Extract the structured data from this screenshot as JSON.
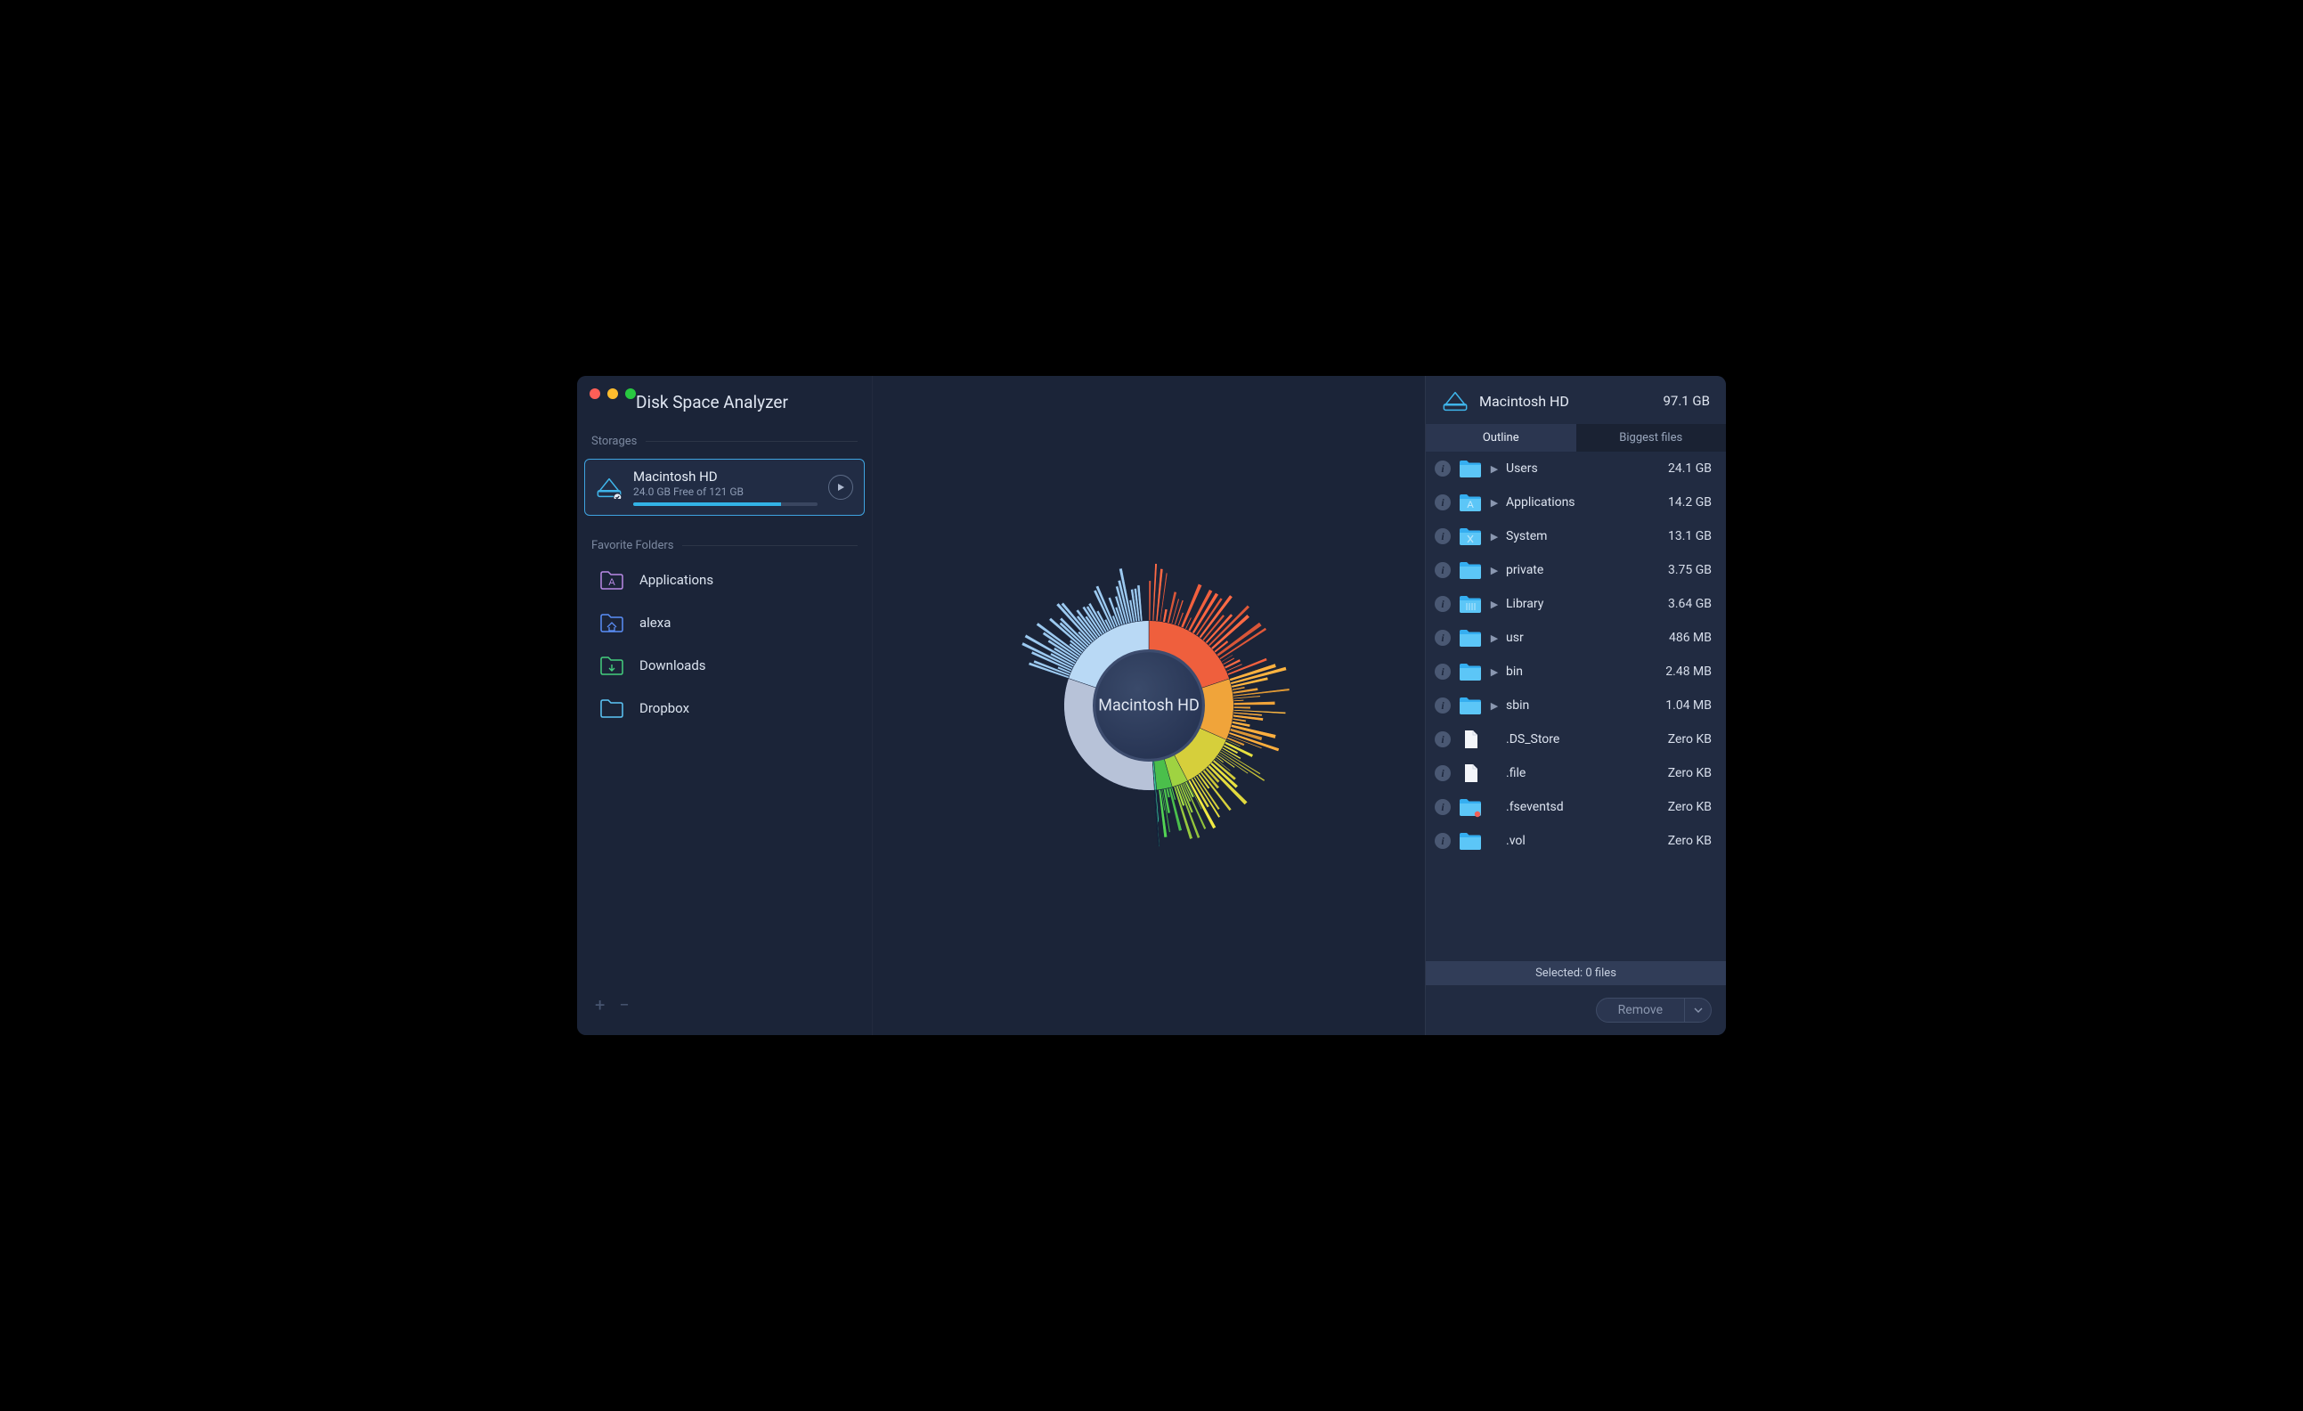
{
  "app_title": "Disk Space Analyzer",
  "sections": {
    "storages": "Storages",
    "favorites": "Favorite Folders"
  },
  "storage": {
    "name": "Macintosh HD",
    "subtitle": "24.0 GB Free of 121 GB",
    "used_pct": 80
  },
  "favorites": [
    {
      "label": "Applications",
      "icon": "applications",
      "tint": "#b98ae6"
    },
    {
      "label": "alexa",
      "icon": "home",
      "tint": "#5a8ef7"
    },
    {
      "label": "Downloads",
      "icon": "downloads",
      "tint": "#44cf7e"
    },
    {
      "label": "Dropbox",
      "icon": "folder",
      "tint": "#5cc6f7"
    }
  ],
  "center_title": "Macintosh HD",
  "right_header": {
    "title": "Macintosh HD",
    "size": "97.1 GB"
  },
  "tabs": {
    "outline": "Outline",
    "biggest": "Biggest files"
  },
  "filelist": [
    {
      "name": "Users",
      "size": "24.1 GB",
      "icon": "folder",
      "disclosure": true
    },
    {
      "name": "Applications",
      "size": "14.2 GB",
      "icon": "applications",
      "disclosure": true
    },
    {
      "name": "System",
      "size": "13.1 GB",
      "icon": "system",
      "disclosure": true
    },
    {
      "name": "private",
      "size": "3.75 GB",
      "icon": "folder",
      "disclosure": true
    },
    {
      "name": "Library",
      "size": "3.64 GB",
      "icon": "library",
      "disclosure": true
    },
    {
      "name": "usr",
      "size": "486 MB",
      "icon": "folder",
      "disclosure": true
    },
    {
      "name": "bin",
      "size": "2.48 MB",
      "icon": "folder",
      "disclosure": true
    },
    {
      "name": "sbin",
      "size": "1.04 MB",
      "icon": "folder",
      "disclosure": true
    },
    {
      "name": ".DS_Store",
      "size": "Zero KB",
      "icon": "file",
      "disclosure": false
    },
    {
      "name": ".file",
      "size": "Zero KB",
      "icon": "file",
      "disclosure": false
    },
    {
      "name": ".fseventsd",
      "size": "Zero KB",
      "icon": "folder-badge",
      "disclosure": false
    },
    {
      "name": ".vol",
      "size": "Zero KB",
      "icon": "folder",
      "disclosure": false
    }
  ],
  "selected_text": "Selected: 0 files",
  "remove_label": "Remove",
  "chart_data": {
    "type": "sunburst",
    "title": "Macintosh HD",
    "total": 97.1,
    "unit": "GB",
    "children": [
      {
        "name": "Users",
        "value": 24.1,
        "color": "#ef5f3d"
      },
      {
        "name": "Applications",
        "value": 14.2,
        "color": "#f0a43a"
      },
      {
        "name": "System",
        "value": 13.1,
        "color": "#d6cf3b"
      },
      {
        "name": "private",
        "value": 3.75,
        "color": "#9fd341"
      },
      {
        "name": "Library",
        "value": 3.64,
        "color": "#4bbf4b"
      },
      {
        "name": "usr",
        "value": 0.486,
        "color": "#3bc79a"
      },
      {
        "name": "bin",
        "value": 0.00248,
        "color": "#3fbfd6"
      },
      {
        "name": "sbin",
        "value": 0.00104,
        "color": "#3f8fe0"
      }
    ],
    "free_space": 24.0,
    "free_color": "#b9d9f5",
    "other_color": "#b7c2d8"
  }
}
